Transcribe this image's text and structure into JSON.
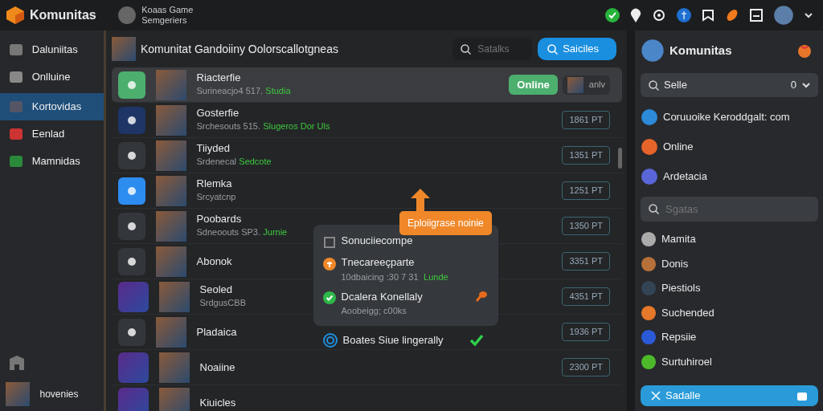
{
  "topbar": {
    "app_name": "Komunitas",
    "game_title": "Koaas Game",
    "game_subtitle": "Semgeriers"
  },
  "sidebar": {
    "items": [
      {
        "label": "Daluniitas",
        "selected": false
      },
      {
        "label": "Onlluine",
        "selected": false
      },
      {
        "label": "Kortovidas",
        "selected": true
      },
      {
        "label": "Eenlad",
        "selected": false
      },
      {
        "label": "Mamnidas",
        "selected": false
      }
    ],
    "user": "hovenies"
  },
  "main": {
    "title": "Komunitat Gandoiiny Oolorscallotgneas",
    "search": {
      "placeholder": "Satalks"
    },
    "search_button": "Saiciles",
    "rows": [
      {
        "name": "Riacterfie",
        "sub": "Surineacjo4 517.",
        "status": "Studia",
        "color": "#4caf6e",
        "selected": true,
        "online": "Online",
        "friend": "anlv"
      },
      {
        "name": "Gosterfie",
        "sub": "Srchesouts 515.",
        "status": "Slugeros Dor Uls",
        "color": "#1e3566",
        "selected": false,
        "points": "1861 PT"
      },
      {
        "name": "Tiiyded",
        "sub": "Srdenecal",
        "status": "Sedcote",
        "color": "#33373c",
        "selected": false,
        "points": "1351 PT"
      },
      {
        "name": "Rlemka",
        "sub": "Srcyatcnp",
        "color": "#2d8cf0",
        "selected": false,
        "points": "1251 PT"
      },
      {
        "name": "Poobards",
        "sub": "Sdneoouts SP3.",
        "status": "Jurnie",
        "color": "#33373c",
        "selected": false,
        "points": "1350 PT"
      },
      {
        "name": "Abonok",
        "color": "#33373c",
        "selected": false,
        "points": "3351 PT"
      },
      {
        "name": "Seoled",
        "sub": "SrdgusCBB",
        "selected": false,
        "points": "4351 PT"
      },
      {
        "name": "Pladaica",
        "color": "#33373c",
        "selected": false,
        "points": "1936 PT"
      },
      {
        "name": "Noaiine",
        "selected": false,
        "points": "2300 PT"
      },
      {
        "name": "Kiuicles",
        "selected": false
      }
    ],
    "tooltip": "Eploiigrase noinie",
    "popup": [
      {
        "kind": "header",
        "title": "Sonuciiecompe"
      },
      {
        "kind": "pending",
        "title": "Tnecareeçparte",
        "sub": "10dbaicing :30 7 31",
        "status": "Lunde"
      },
      {
        "kind": "done",
        "title": "Dcalera Konellaly",
        "sub": "Aoobeigg; c00ks"
      }
    ],
    "note": {
      "text": "Boates Siue lingerally",
      "checked": true
    }
  },
  "panel": {
    "title": "Komunitas",
    "select": {
      "value": "Selle",
      "count": "0"
    },
    "items": [
      "Coruuoike Keroddgalt: com",
      "Online",
      "Ardetacia"
    ],
    "search": {
      "placeholder": "Sgatas"
    },
    "friends": [
      "Mamita",
      "Donis",
      "Piestiols",
      "Suchended",
      "Repsiie",
      "Surtuhiroel"
    ],
    "button": "Sadalle"
  }
}
